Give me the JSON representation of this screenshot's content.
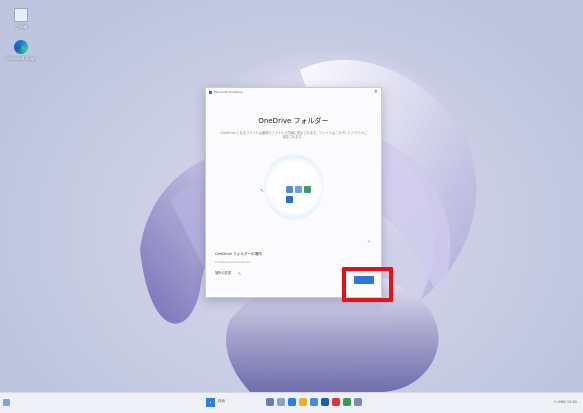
{
  "desktop": {
    "icons": [
      {
        "label": "ごみ箱",
        "icon": "recycle-bin-icon"
      },
      {
        "label": "Microsoft Edge",
        "icon": "edge-icon"
      }
    ]
  },
  "dialog": {
    "window_title": "Microsoft OneDrive",
    "close_glyph": "×",
    "heading": "OneDrive フォルダー",
    "description": "OneDrive にあるファイルは通常のファイルと同様に表示されます。ファイルはこの PC とクラウドに保存されます。",
    "status_title": "OneDrive フォルダーの場所",
    "status_path": "C:\\Users\\user\\OneDrive",
    "details_link": "場所の変更",
    "corner_glyph": "+",
    "primary_button": "次へ"
  },
  "taskbar": {
    "search_label": "検索",
    "tray_text": "へ  ENG  12:00"
  },
  "colors": {
    "accent": "#2b79d3",
    "highlight_box": "#e0121b"
  }
}
